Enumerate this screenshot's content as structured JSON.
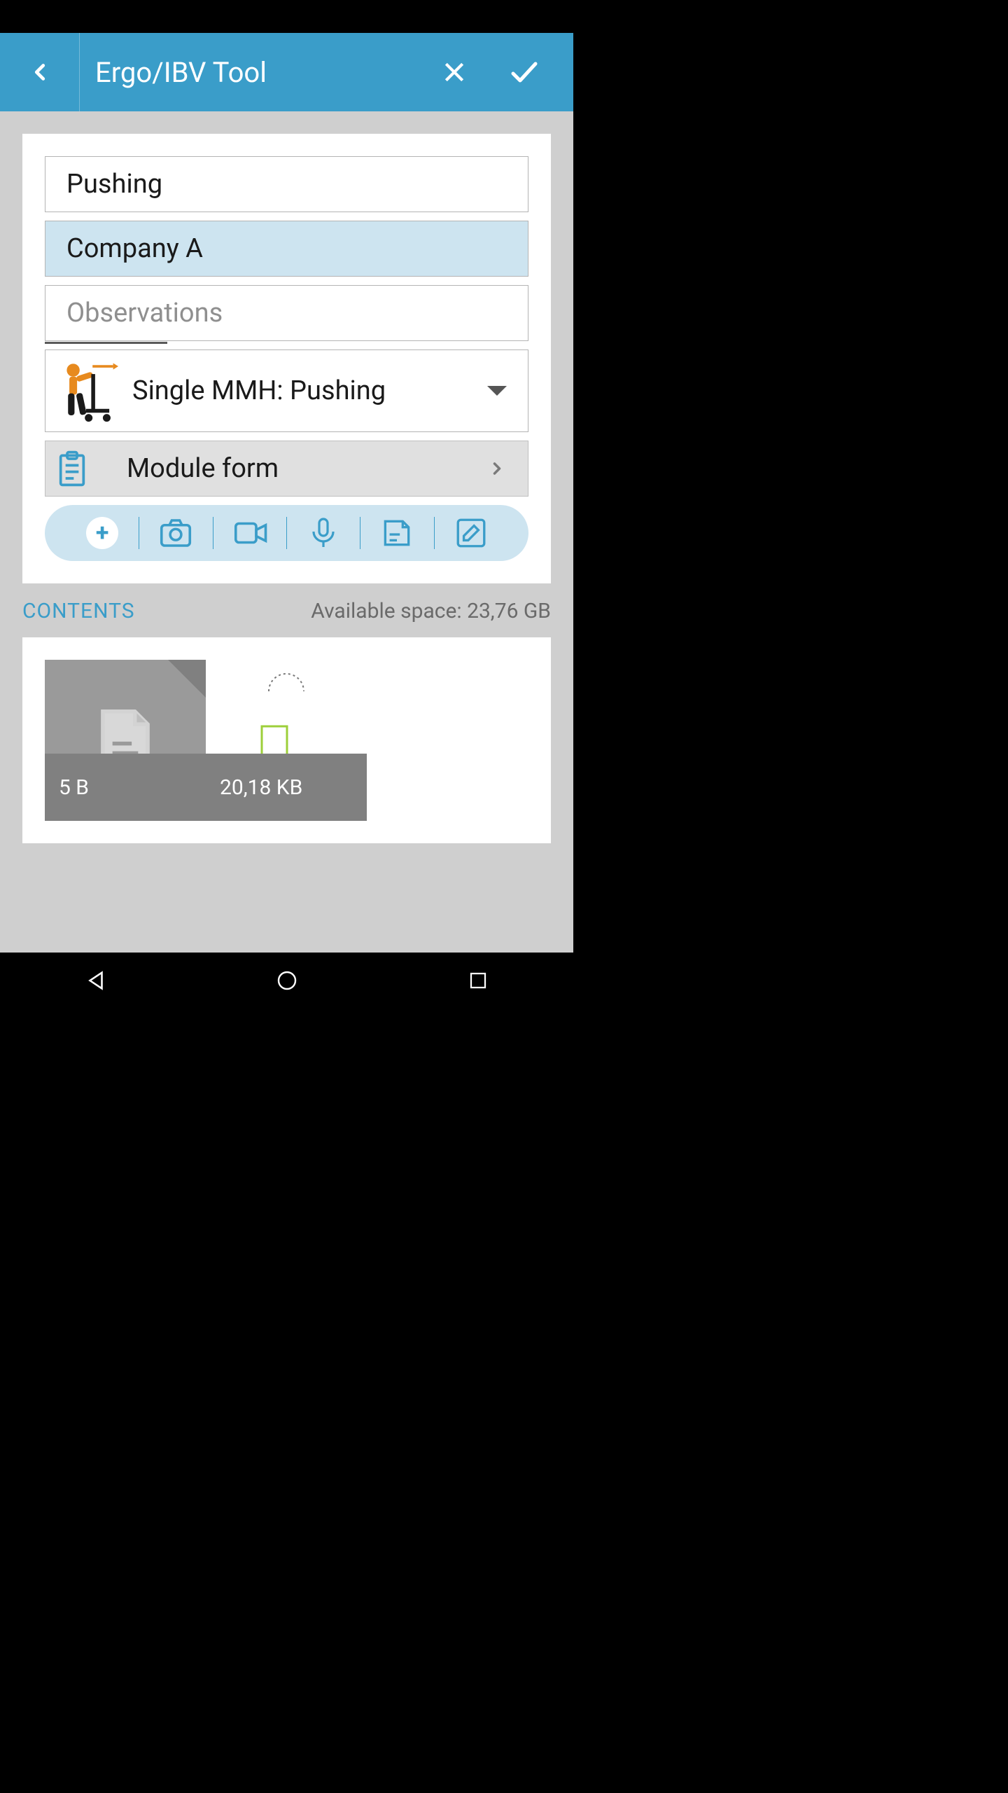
{
  "header": {
    "title": "Ergo/IBV Tool"
  },
  "form": {
    "task_value": "Pushing",
    "company_value": "Company A",
    "observations_placeholder": "Observations",
    "method_label": "Single MMH: Pushing",
    "module_form_label": "Module form"
  },
  "contents": {
    "heading": "CONTENTS",
    "available_space": "Available space: 23,76 GB",
    "items": [
      {
        "size": "5 B"
      },
      {
        "size": "20,18 KB"
      }
    ]
  },
  "colors": {
    "primary": "#3a9dc9",
    "accent_light": "#cde4f0"
  }
}
